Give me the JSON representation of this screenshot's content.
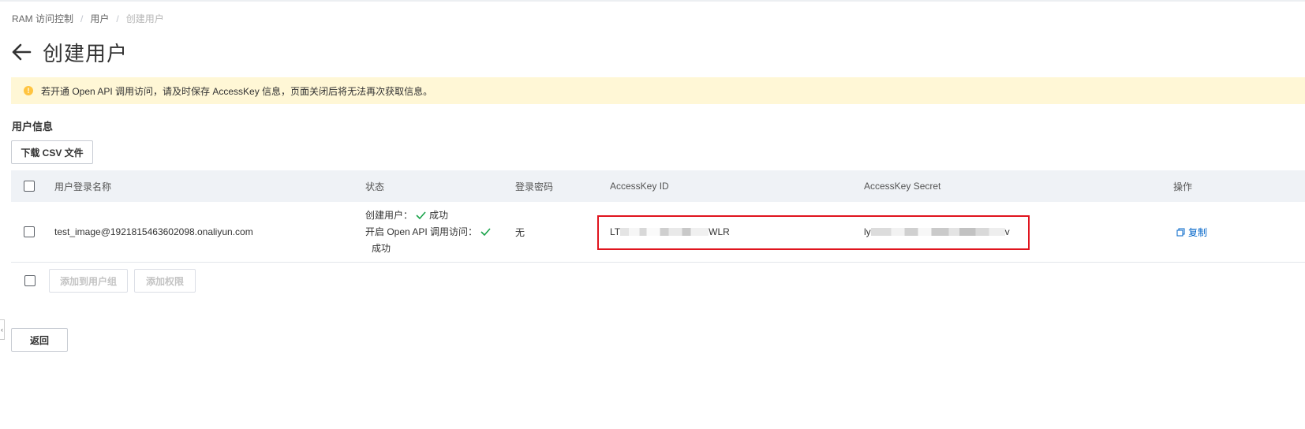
{
  "breadcrumb": {
    "items": [
      "RAM 访问控制",
      "用户",
      "创建用户"
    ]
  },
  "page": {
    "title": "创建用户"
  },
  "alert": {
    "text": "若开通 Open API 调用访问，请及时保存 AccessKey 信息，页面关闭后将无法再次获取信息。",
    "color": "#ffc440"
  },
  "section": {
    "title": "用户信息",
    "download_label": "下载 CSV 文件"
  },
  "table": {
    "headers": [
      "用户登录名称",
      "状态",
      "登录密码",
      "AccessKey ID",
      "AccessKey Secret",
      "操作"
    ],
    "rows": [
      {
        "login_name": "test_image@1921815463602098.onaliyun.com",
        "status_create_label": "创建用户：",
        "status_create_result": "成功",
        "status_api_label": "开启 Open API 调用访问：",
        "status_api_result": "成功",
        "password": "无",
        "access_key_id_prefix": "LT",
        "access_key_id_suffix": "WLR",
        "access_key_secret_prefix": "ly",
        "access_key_secret_suffix": "v",
        "action_label": "复制"
      }
    ]
  },
  "footer_actions": {
    "add_to_group_label": "添加到用户组",
    "add_permission_label": "添加权限"
  },
  "back_button_label": "返回",
  "colors": {
    "link": "#0064c8",
    "success": "#1aa34a",
    "highlight_border": "#e0141e",
    "table_header_bg": "#eff2f6"
  }
}
